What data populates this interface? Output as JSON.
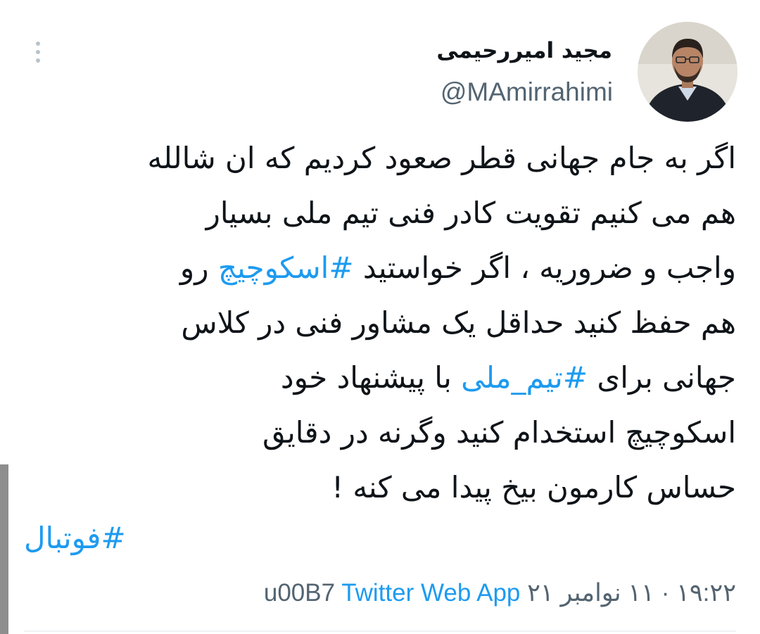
{
  "author": {
    "display_name": "مجید امیررحیمی",
    "handle": "@MAmirrahimi"
  },
  "tweet": {
    "lines": [
      {
        "segments": [
          {
            "text": "اگر به جام جهانی قطر صعود کردیم که ان شالله"
          }
        ]
      },
      {
        "segments": [
          {
            "text": "هم می کنیم تقویت کادر فنی تیم ملی بسیار"
          }
        ]
      },
      {
        "segments": [
          {
            "text": "واجب و ضروریه ، اگر خواستید "
          },
          {
            "text": "#اسکوچیچ",
            "hashtag": true
          },
          {
            "text": " رو"
          }
        ]
      },
      {
        "segments": [
          {
            "text": "هم حفظ کنید حداقل یک مشاور فنی در کلاس"
          }
        ]
      },
      {
        "segments": [
          {
            "text": "جهانی برای "
          },
          {
            "text": "#تیم_ملی",
            "hashtag": true
          },
          {
            "text": " با پیشنهاد خود"
          }
        ]
      },
      {
        "segments": [
          {
            "text": "اسکوچیچ استخدام کنید وگرنه در دقایق"
          }
        ]
      },
      {
        "segments": [
          {
            "text": "حساس کارمون بیخ پیدا می کنه !"
          }
        ]
      }
    ],
    "trailing_hashtag": "#فوتبال"
  },
  "meta": {
    "timestamp": "۱۹:۲۲ · ۱۱ نوامبر ۲۱",
    "separator": "u00B7",
    "source": "Twitter Web App"
  },
  "icons": {
    "more": "more-vertical-icon"
  },
  "colors": {
    "link": "#1d9bf0",
    "secondary_text": "#536471",
    "primary_text": "#0f1419"
  }
}
